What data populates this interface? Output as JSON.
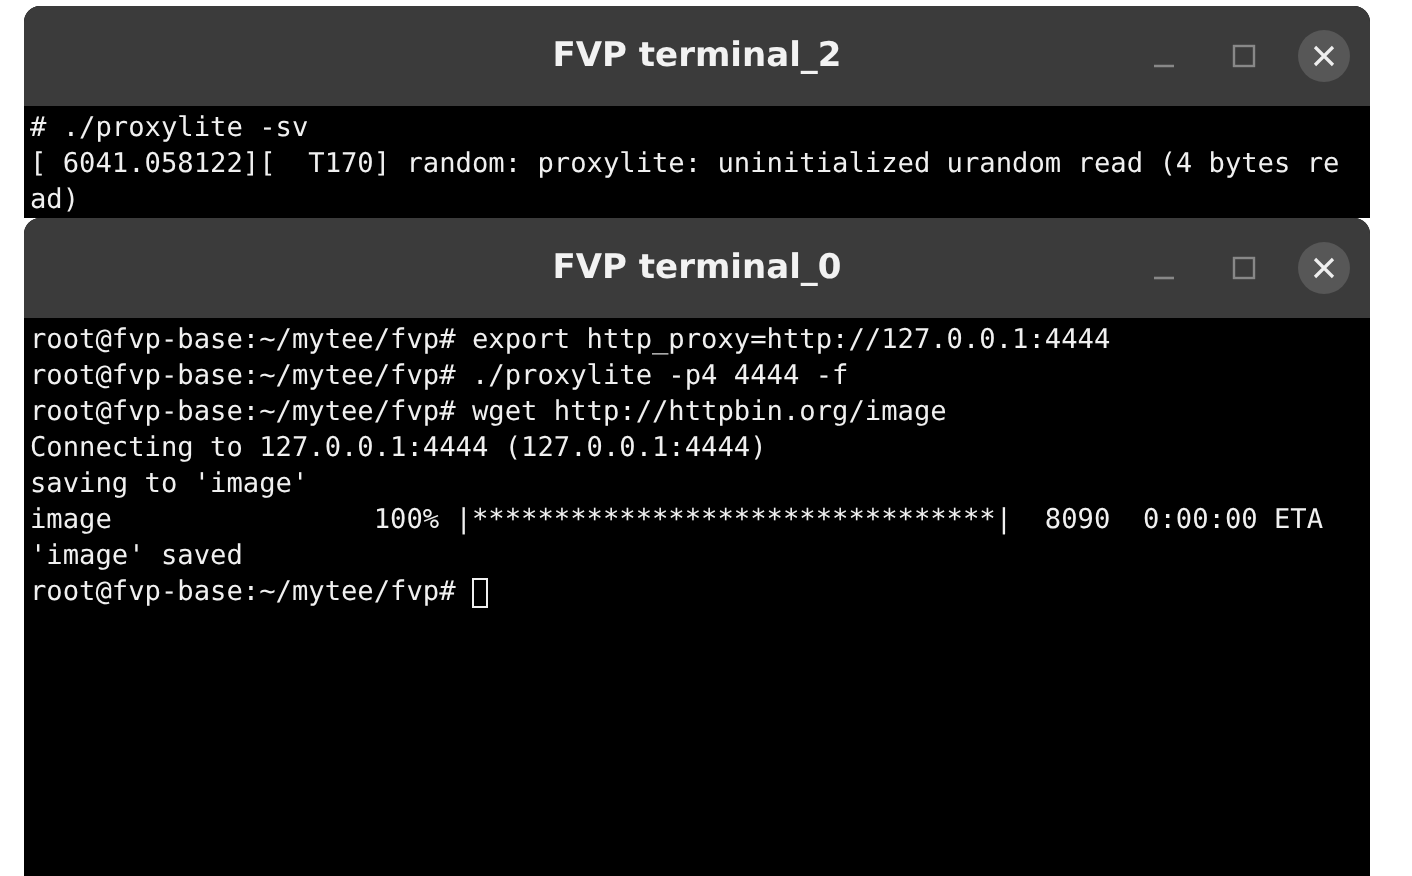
{
  "windows": [
    {
      "title": "FVP terminal_2",
      "cursor": false,
      "lines": [
        "# ./proxylite -sv",
        "[ 6041.058122][  T170] random: proxylite: uninitialized urandom read (4 bytes re",
        "ad)"
      ]
    },
    {
      "title": "FVP terminal_0",
      "cursor": true,
      "lines": [
        "root@fvp-base:~/mytee/fvp# export http_proxy=http://127.0.0.1:4444",
        "root@fvp-base:~/mytee/fvp# ./proxylite -p4 4444 -f",
        "root@fvp-base:~/mytee/fvp# wget http://httpbin.org/image",
        "Connecting to 127.0.0.1:4444 (127.0.0.1:4444)",
        "saving to 'image'",
        "image                100% |********************************|  8090  0:00:00 ETA",
        "'image' saved",
        "root@fvp-base:~/mytee/fvp# "
      ]
    }
  ]
}
